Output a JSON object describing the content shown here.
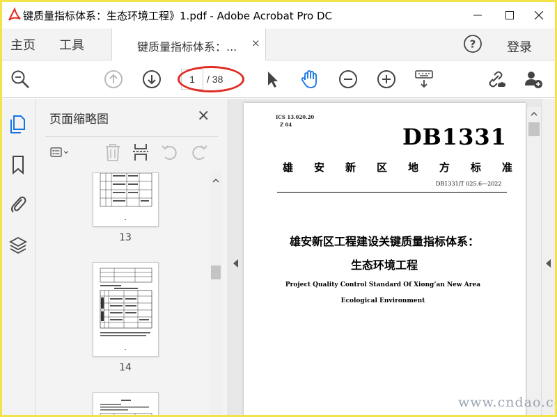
{
  "window": {
    "title": "键质量指标体系：生态环境工程》1.pdf - Adobe Acrobat Pro DC"
  },
  "tabbar": {
    "home": "主页",
    "tools": "工具",
    "doc_tab": "键质量指标体系：...",
    "doc_tab_close": "×",
    "signin": "登录"
  },
  "toolbar": {
    "page_current": "1",
    "page_total": "/ 38"
  },
  "thumbnails": {
    "title": "页面缩略图",
    "close": "×",
    "pages": [
      {
        "number": "13"
      },
      {
        "number": "14"
      }
    ]
  },
  "document": {
    "ics": "ICS 13.020.20",
    "zcode": "Z 04",
    "std_logo": "DB1331",
    "std_name_chars": [
      "雄",
      "安",
      "新",
      "区",
      "地",
      "方",
      "标",
      "准"
    ],
    "std_number": "DB1331/T 025.6—2022",
    "title_cn_line1": "雄安新区工程建设关键质量指标体系：",
    "title_cn_line2": "生态环境工程",
    "title_en_line1": "Project Quality Control Standard Of Xiong’an New Area",
    "title_en_line2": "Ecological Environment"
  },
  "watermark": "www.cndao.com",
  "colors": {
    "frame": "#f2e34a",
    "highlight_ellipse": "#e02a22",
    "active_icon": "#1473e6"
  }
}
